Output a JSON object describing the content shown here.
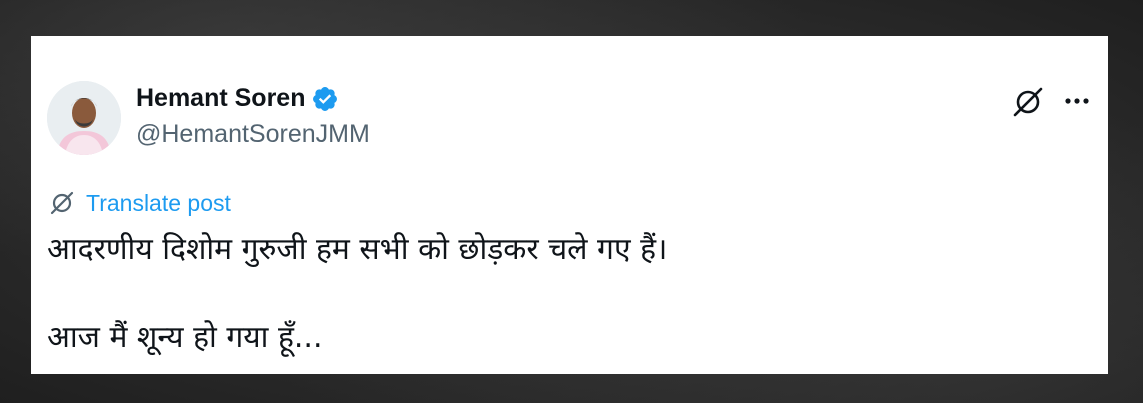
{
  "author": {
    "display_name": "Hemant Soren",
    "handle": "@HemantSorenJMM",
    "verified": true
  },
  "icons": {
    "avatar": "profile-photo",
    "verified": "verified-badge-icon",
    "grok": "grok-icon",
    "more": "more-options-icon",
    "translate": "grok-translate-icon"
  },
  "colors": {
    "accent": "#1d9bf0",
    "text_primary": "#0f1419",
    "text_secondary": "#536471"
  },
  "translate": {
    "label": "Translate post"
  },
  "post": {
    "lines": [
      "आदरणीय दिशोम गुरुजी हम सभी को छोड़कर चले गए हैं।",
      "आज मैं शून्य हो गया हूँ..."
    ]
  }
}
